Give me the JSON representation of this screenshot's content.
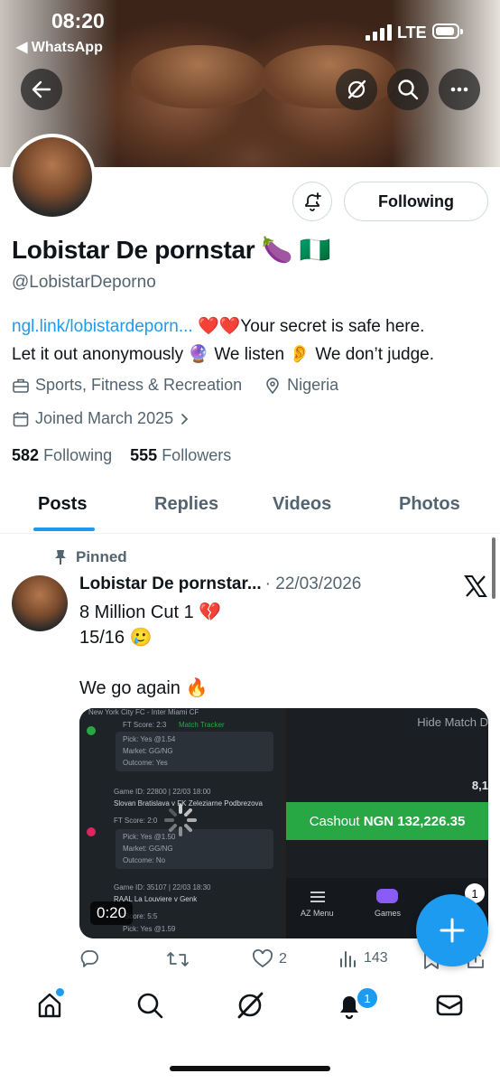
{
  "status_bar": {
    "time": "08:20",
    "back_app": "◀ WhatsApp",
    "network": "LTE"
  },
  "profile": {
    "name": "Lobistar De pornstar 🍆 🇳🇬",
    "handle": "@LobistarDeporno",
    "bio_link": "ngl.link/lobistardeporn...",
    "bio_line1_rest": " ❤️❤️Your secret is safe here.",
    "bio_line2": "Let it out anonymously 🔮 We listen 👂 We don’t judge.",
    "category": "Sports, Fitness & Recreation",
    "location": "Nigeria",
    "joined": "Joined March 2025",
    "following_count": "582",
    "following_label": "Following",
    "followers_count": "555",
    "followers_label": "Followers",
    "follow_button": "Following"
  },
  "tabs": [
    "Posts",
    "Replies",
    "Videos",
    "Photos"
  ],
  "post": {
    "pinned_label": "Pinned",
    "author": "Lobistar De pornstar...",
    "date": "· 22/03/2026",
    "text_line1": "8 Million Cut 1 💔",
    "text_line2": "15/16 🥲",
    "text_line3": "We go again 🔥",
    "video_duration": "0:20",
    "media_right": {
      "hide_label": "Hide Match D",
      "partial_amount": "8,1",
      "cashout_label": "Cashout",
      "cashout_amount": "NGN 132,226.35",
      "menu_label": "AZ Menu",
      "games_label": "Games",
      "badge": "1"
    },
    "media_left": {
      "top_title": "New York City FC - Inter Miami CF",
      "score1": "FT Score:  2:3",
      "tracker": "Match Tracker",
      "pick1": "Pick:   Yes @1.54",
      "market1": "Market:  GG/NG",
      "outcome1": "Outcome:  Yes",
      "game2_id": "Game ID: 22800 | 22/03 18:00",
      "game2_title": "Slovan Bratislava v FK Zeleziarne Podbrezova",
      "score2": "FT Score:  2:0",
      "pick2": "Pick:   Yes @1.50",
      "market2": "Market:  GG/NG",
      "outcome2": "Outcome:  No",
      "game3_id": "Game ID: 35107 | 22/03 18:30",
      "game3_title": "RAAL La Louviere v Genk",
      "score3": "FT Score:  5:5",
      "pick3": "Pick:   Yes @1.59"
    },
    "replies": "",
    "reposts": "",
    "likes": "2",
    "views": "143"
  },
  "nav_badge": "1",
  "colors": {
    "accent": "#1d9bf0",
    "muted": "#536471",
    "text": "#0f1419",
    "green": "#27a844"
  }
}
